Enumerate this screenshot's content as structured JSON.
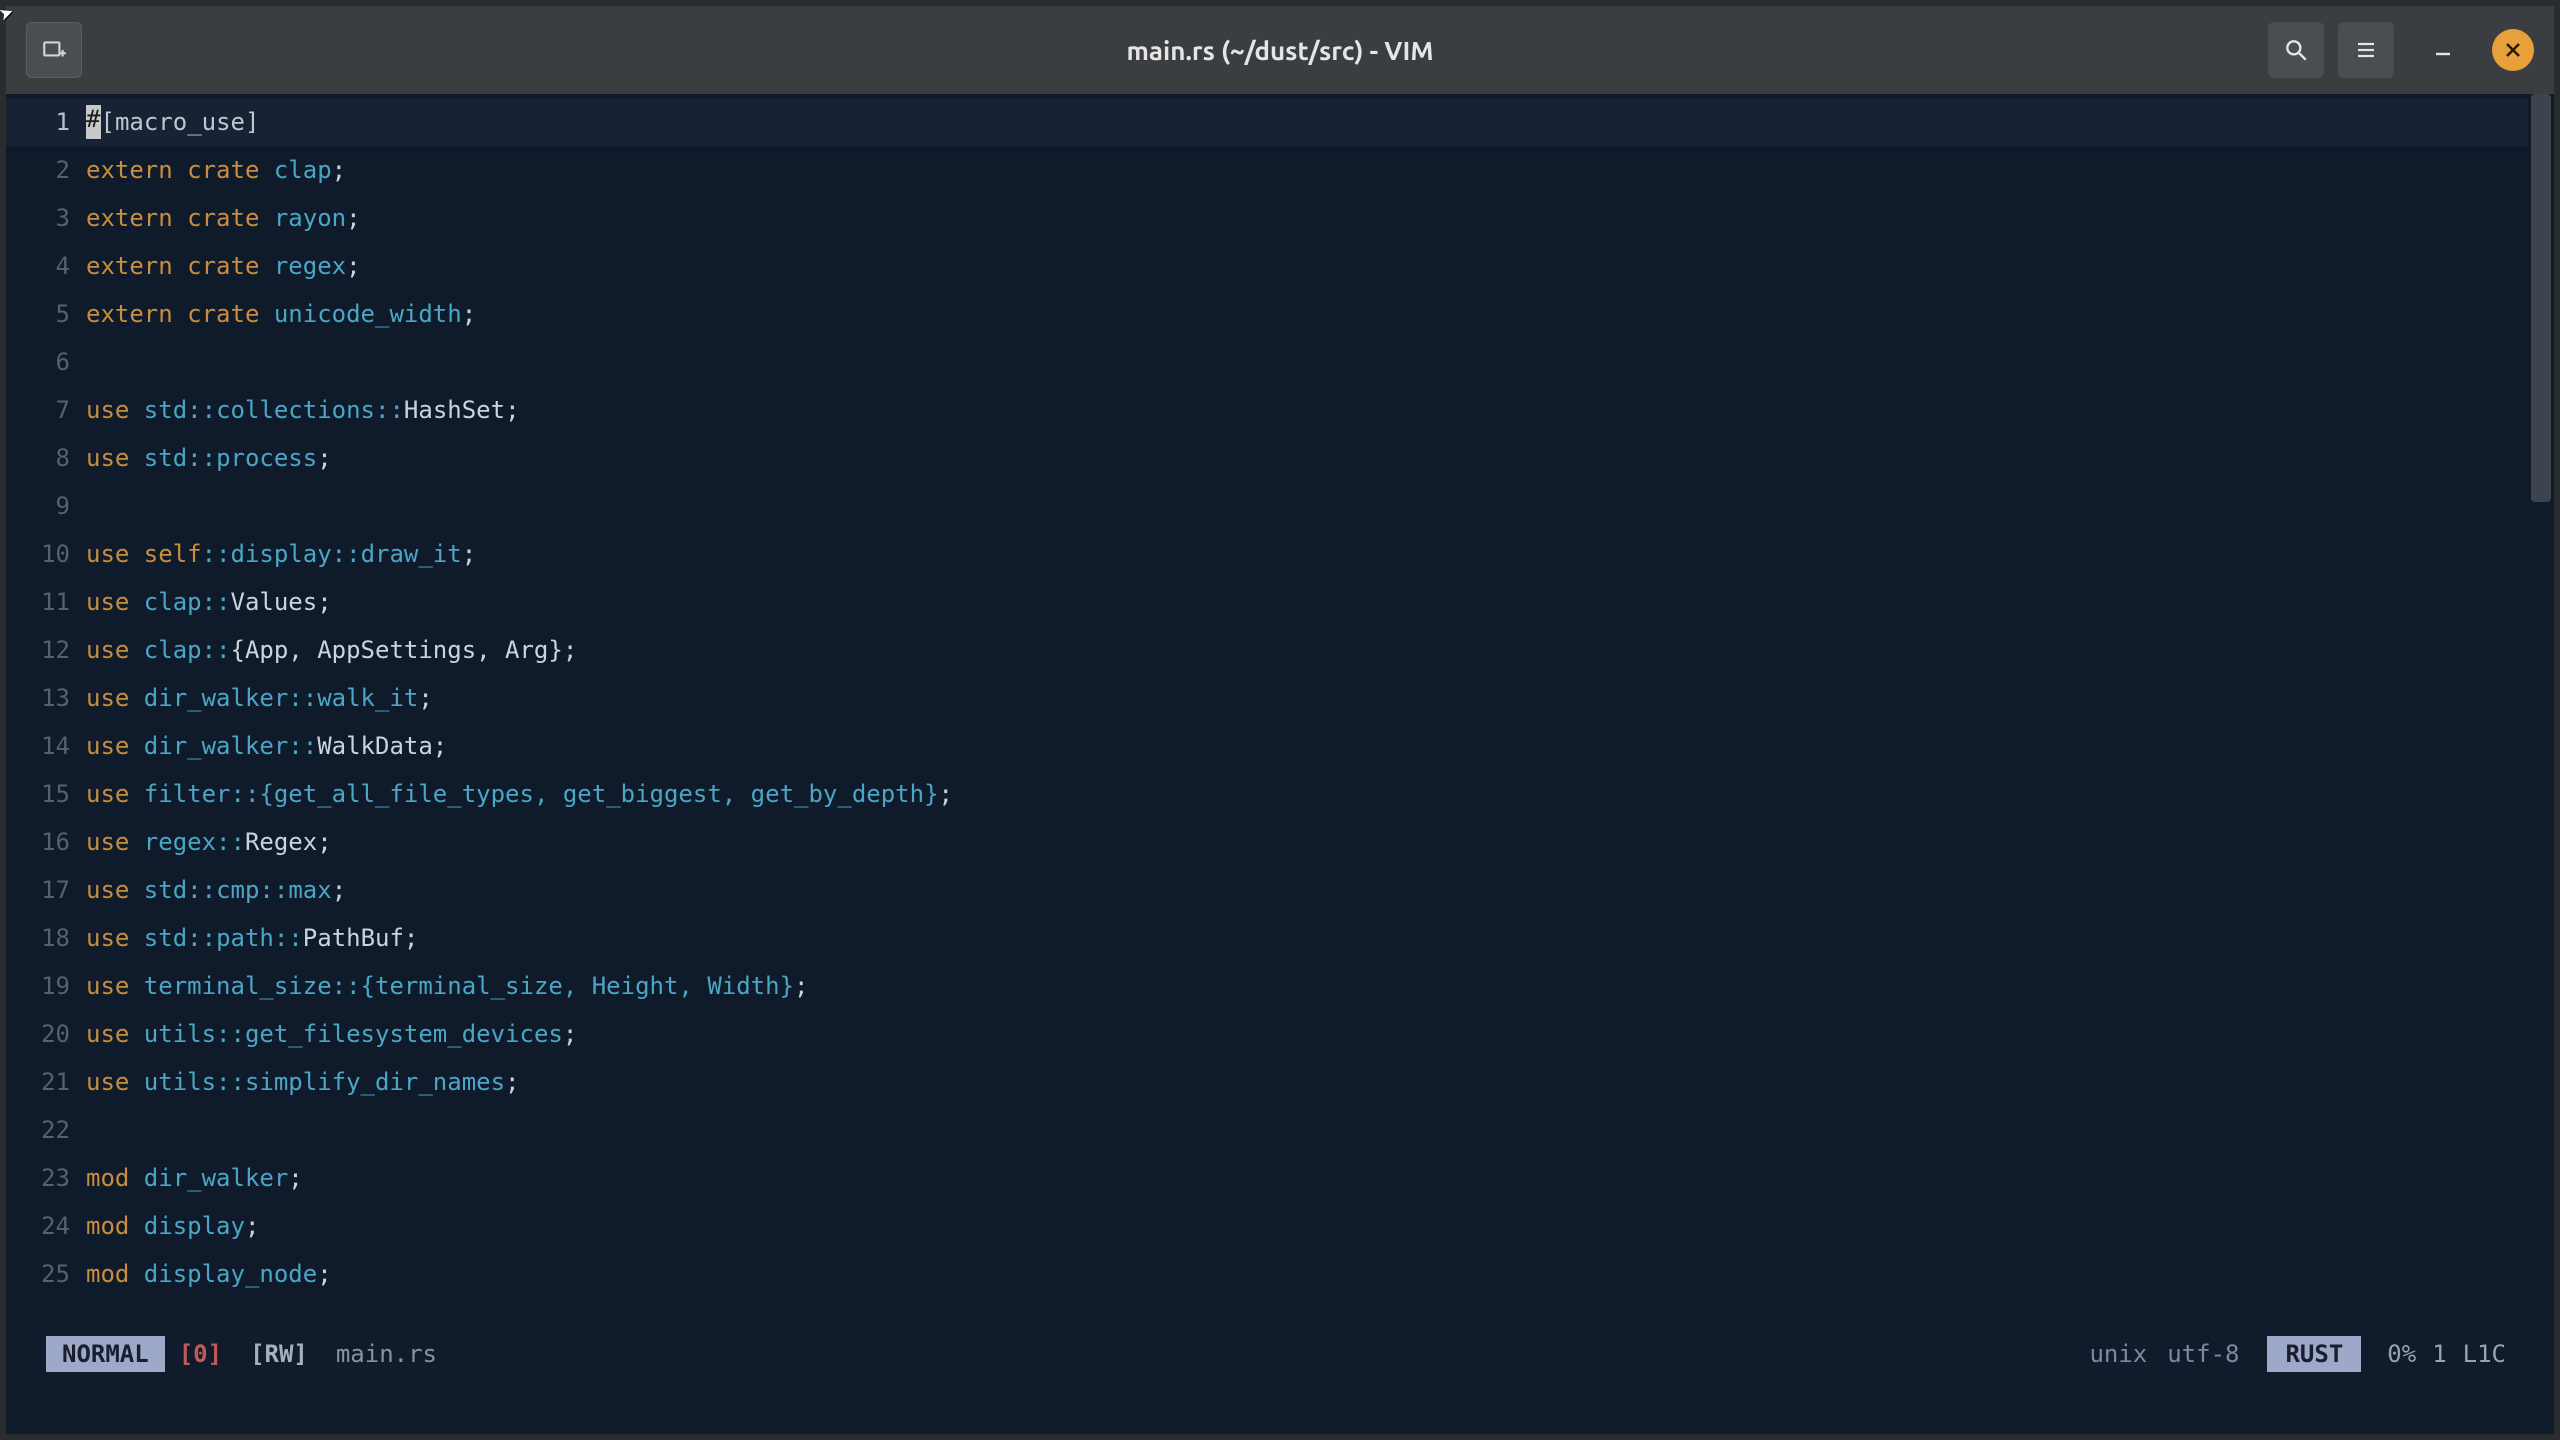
{
  "window": {
    "title": "main.rs (~/dust/src) - VIM"
  },
  "statusbar": {
    "mode": "NORMAL",
    "modified": "[0]",
    "rw": "[RW]",
    "filename": "main.rs",
    "fileformat": "unix",
    "encoding": "utf-8",
    "language": "RUST",
    "percent": "0%",
    "line": "1",
    "colpos": "L1C"
  },
  "code": {
    "lines": [
      {
        "n": 1,
        "current": true,
        "tokens": [
          {
            "t": "#",
            "c": "cursor"
          },
          {
            "t": "[macro_use]",
            "c": "attr"
          }
        ]
      },
      {
        "n": 2,
        "tokens": [
          {
            "t": "extern crate ",
            "c": "kw"
          },
          {
            "t": "clap",
            "c": "ident"
          },
          {
            "t": ";",
            "c": "white"
          }
        ]
      },
      {
        "n": 3,
        "tokens": [
          {
            "t": "extern crate ",
            "c": "kw"
          },
          {
            "t": "rayon",
            "c": "ident"
          },
          {
            "t": ";",
            "c": "white"
          }
        ]
      },
      {
        "n": 4,
        "tokens": [
          {
            "t": "extern crate ",
            "c": "kw"
          },
          {
            "t": "regex",
            "c": "ident"
          },
          {
            "t": ";",
            "c": "white"
          }
        ]
      },
      {
        "n": 5,
        "tokens": [
          {
            "t": "extern crate ",
            "c": "kw"
          },
          {
            "t": "unicode_width",
            "c": "ident"
          },
          {
            "t": ";",
            "c": "white"
          }
        ]
      },
      {
        "n": 6,
        "tokens": []
      },
      {
        "n": 7,
        "tokens": [
          {
            "t": "use ",
            "c": "kw"
          },
          {
            "t": "std",
            "c": "ident"
          },
          {
            "t": "::",
            "c": "punct"
          },
          {
            "t": "collections",
            "c": "ident"
          },
          {
            "t": "::",
            "c": "punct"
          },
          {
            "t": "HashSet",
            "c": "white"
          },
          {
            "t": ";",
            "c": "white"
          }
        ]
      },
      {
        "n": 8,
        "tokens": [
          {
            "t": "use ",
            "c": "kw"
          },
          {
            "t": "std",
            "c": "ident"
          },
          {
            "t": "::",
            "c": "punct"
          },
          {
            "t": "process",
            "c": "ident"
          },
          {
            "t": ";",
            "c": "white"
          }
        ]
      },
      {
        "n": 9,
        "tokens": []
      },
      {
        "n": 10,
        "tokens": [
          {
            "t": "use ",
            "c": "kw"
          },
          {
            "t": "self",
            "c": "kw"
          },
          {
            "t": "::",
            "c": "punct"
          },
          {
            "t": "display",
            "c": "ident"
          },
          {
            "t": "::",
            "c": "punct"
          },
          {
            "t": "draw_it",
            "c": "ident"
          },
          {
            "t": ";",
            "c": "white"
          }
        ]
      },
      {
        "n": 11,
        "tokens": [
          {
            "t": "use ",
            "c": "kw"
          },
          {
            "t": "clap",
            "c": "ident"
          },
          {
            "t": "::",
            "c": "punct"
          },
          {
            "t": "Values",
            "c": "white"
          },
          {
            "t": ";",
            "c": "white"
          }
        ]
      },
      {
        "n": 12,
        "tokens": [
          {
            "t": "use ",
            "c": "kw"
          },
          {
            "t": "clap",
            "c": "ident"
          },
          {
            "t": "::",
            "c": "punct"
          },
          {
            "t": "{App, AppSettings, Arg}",
            "c": "white"
          },
          {
            "t": ";",
            "c": "white"
          }
        ]
      },
      {
        "n": 13,
        "tokens": [
          {
            "t": "use ",
            "c": "kw"
          },
          {
            "t": "dir_walker",
            "c": "ident"
          },
          {
            "t": "::",
            "c": "punct"
          },
          {
            "t": "walk_it",
            "c": "ident"
          },
          {
            "t": ";",
            "c": "white"
          }
        ]
      },
      {
        "n": 14,
        "tokens": [
          {
            "t": "use ",
            "c": "kw"
          },
          {
            "t": "dir_walker",
            "c": "ident"
          },
          {
            "t": "::",
            "c": "punct"
          },
          {
            "t": "WalkData",
            "c": "white"
          },
          {
            "t": ";",
            "c": "white"
          }
        ]
      },
      {
        "n": 15,
        "tokens": [
          {
            "t": "use ",
            "c": "kw"
          },
          {
            "t": "filter",
            "c": "ident"
          },
          {
            "t": "::",
            "c": "punct"
          },
          {
            "t": "{get_all_file_types, get_biggest, get_by_depth}",
            "c": "ident"
          },
          {
            "t": ";",
            "c": "white"
          }
        ]
      },
      {
        "n": 16,
        "tokens": [
          {
            "t": "use ",
            "c": "kw"
          },
          {
            "t": "regex",
            "c": "ident"
          },
          {
            "t": "::",
            "c": "punct"
          },
          {
            "t": "Regex",
            "c": "white"
          },
          {
            "t": ";",
            "c": "white"
          }
        ]
      },
      {
        "n": 17,
        "tokens": [
          {
            "t": "use ",
            "c": "kw"
          },
          {
            "t": "std",
            "c": "ident"
          },
          {
            "t": "::",
            "c": "punct"
          },
          {
            "t": "cmp",
            "c": "ident"
          },
          {
            "t": "::",
            "c": "punct"
          },
          {
            "t": "max",
            "c": "ident"
          },
          {
            "t": ";",
            "c": "white"
          }
        ]
      },
      {
        "n": 18,
        "tokens": [
          {
            "t": "use ",
            "c": "kw"
          },
          {
            "t": "std",
            "c": "ident"
          },
          {
            "t": "::",
            "c": "punct"
          },
          {
            "t": "path",
            "c": "ident"
          },
          {
            "t": "::",
            "c": "punct"
          },
          {
            "t": "PathBuf",
            "c": "white"
          },
          {
            "t": ";",
            "c": "white"
          }
        ]
      },
      {
        "n": 19,
        "tokens": [
          {
            "t": "use ",
            "c": "kw"
          },
          {
            "t": "terminal_size",
            "c": "ident"
          },
          {
            "t": "::",
            "c": "punct"
          },
          {
            "t": "{terminal_size, Height, Width}",
            "c": "ident"
          },
          {
            "t": ";",
            "c": "white"
          }
        ]
      },
      {
        "n": 20,
        "tokens": [
          {
            "t": "use ",
            "c": "kw"
          },
          {
            "t": "utils",
            "c": "ident"
          },
          {
            "t": "::",
            "c": "punct"
          },
          {
            "t": "get_filesystem_devices",
            "c": "ident"
          },
          {
            "t": ";",
            "c": "white"
          }
        ]
      },
      {
        "n": 21,
        "tokens": [
          {
            "t": "use ",
            "c": "kw"
          },
          {
            "t": "utils",
            "c": "ident"
          },
          {
            "t": "::",
            "c": "punct"
          },
          {
            "t": "simplify_dir_names",
            "c": "ident"
          },
          {
            "t": ";",
            "c": "white"
          }
        ]
      },
      {
        "n": 22,
        "tokens": []
      },
      {
        "n": 23,
        "tokens": [
          {
            "t": "mod ",
            "c": "kw"
          },
          {
            "t": "dir_walker",
            "c": "ident"
          },
          {
            "t": ";",
            "c": "white"
          }
        ]
      },
      {
        "n": 24,
        "tokens": [
          {
            "t": "mod ",
            "c": "kw"
          },
          {
            "t": "display",
            "c": "ident"
          },
          {
            "t": ";",
            "c": "white"
          }
        ]
      },
      {
        "n": 25,
        "tokens": [
          {
            "t": "mod ",
            "c": "kw"
          },
          {
            "t": "display_node",
            "c": "ident"
          },
          {
            "t": ";",
            "c": "white"
          }
        ]
      }
    ]
  }
}
